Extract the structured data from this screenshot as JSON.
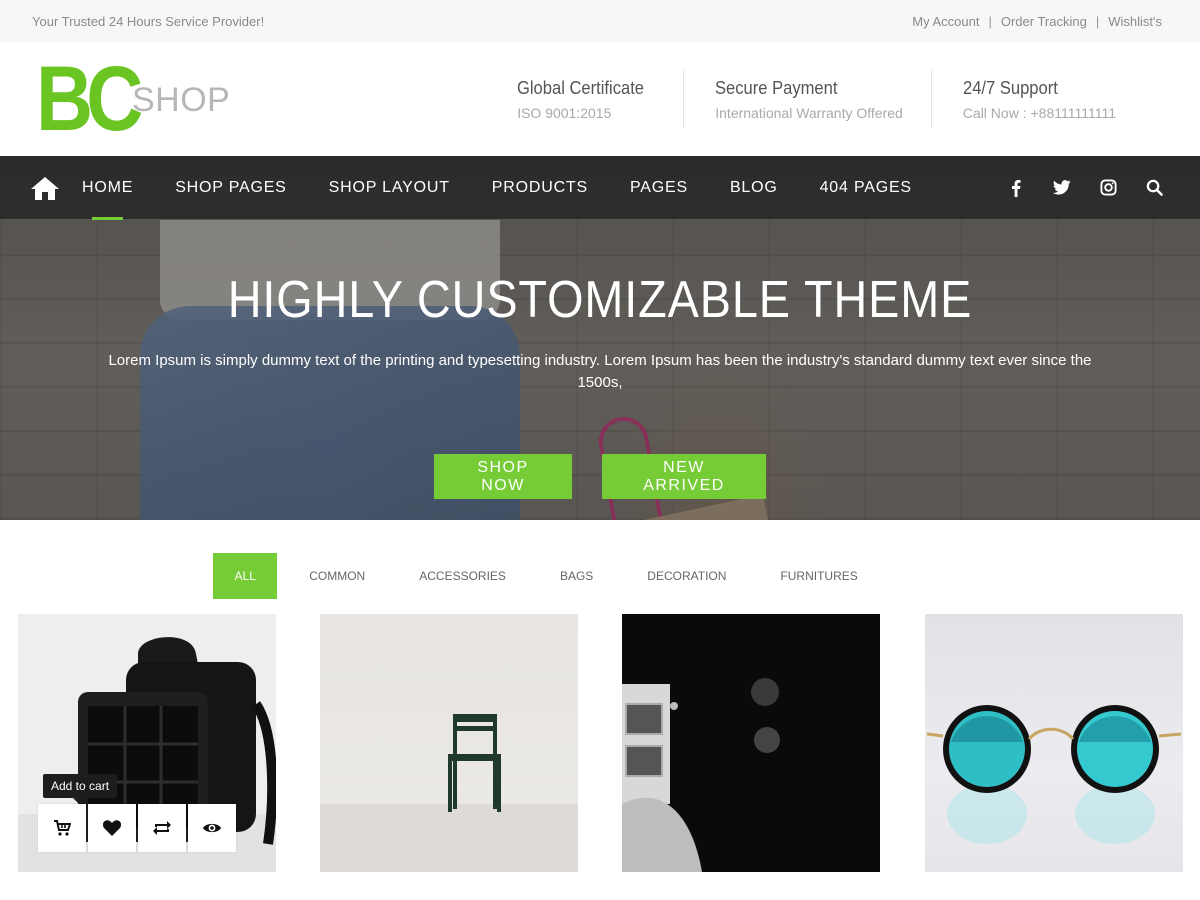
{
  "topbar": {
    "tagline": "Your Trusted 24 Hours Service Provider!",
    "links": [
      "My Account",
      "Order Tracking",
      "Wishlist's"
    ]
  },
  "logo": {
    "mark": "BC",
    "text": "SHOP"
  },
  "features": [
    {
      "title": "Global Certificate",
      "subtitle": "ISO 9001:2015"
    },
    {
      "title": "Secure Payment",
      "subtitle": "International Warranty Offered"
    },
    {
      "title": "24/7 Support",
      "subtitle": "Call Now : +88111111111"
    }
  ],
  "nav": {
    "items": [
      "HOME",
      "SHOP PAGES",
      "SHOP LAYOUT",
      "PRODUCTS",
      "PAGES",
      "BLOG",
      "404 PAGES"
    ],
    "active": "HOME",
    "social_icons": [
      "facebook-icon",
      "twitter-icon",
      "instagram-icon",
      "search-icon"
    ]
  },
  "hero": {
    "title": "HIGHLY CUSTOMIZABLE THEME",
    "text": "Lorem Ipsum is simply dummy text of the printing and typesetting industry. Lorem Ipsum has been the industry's standard dummy text ever since the 1500s,",
    "btn_primary": "SHOP NOW",
    "btn_secondary": "NEW ARRIVED"
  },
  "filters": {
    "items": [
      "ALL",
      "COMMON",
      "ACCESSORIES",
      "BAGS",
      "DECORATION",
      "FURNITURES"
    ],
    "active": "ALL"
  },
  "products": {
    "tooltip": "Add to cart",
    "action_icons": [
      "cart-icon",
      "heart-icon",
      "compare-icon",
      "eye-icon"
    ]
  },
  "colors": {
    "accent": "#76cc36",
    "logo_green": "#6ac523",
    "nav_bg": "#222222"
  }
}
